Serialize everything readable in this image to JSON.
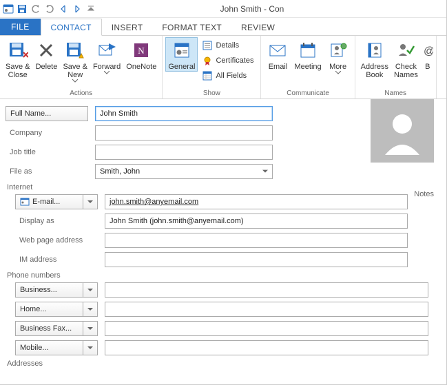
{
  "window": {
    "title": "John Smith - Con"
  },
  "tabs": {
    "file": "FILE",
    "contact": "CONTACT",
    "insert": "INSERT",
    "format_text": "FORMAT TEXT",
    "review": "REVIEW"
  },
  "ribbon": {
    "actions": {
      "save_close": "Save &\nClose",
      "delete": "Delete",
      "save_new": "Save &\nNew",
      "forward": "Forward",
      "onenote": "OneNote",
      "group": "Actions"
    },
    "show": {
      "general": "General",
      "details": "Details",
      "certificates": "Certificates",
      "all_fields": "All Fields",
      "group": "Show"
    },
    "communicate": {
      "email": "Email",
      "meeting": "Meeting",
      "more": "More",
      "group": "Communicate"
    },
    "names": {
      "address_book": "Address\nBook",
      "check_names": "Check\nNames",
      "group": "Names"
    },
    "options_partial": "B"
  },
  "form": {
    "full_name_btn": "Full Name...",
    "full_name_val": "John Smith",
    "company_lbl": "Company",
    "company_val": "",
    "job_title_lbl": "Job title",
    "job_title_val": "",
    "file_as_lbl": "File as",
    "file_as_val": "Smith, John",
    "internet_section": "Internet",
    "email_btn": "E-mail...",
    "email_val": "john.smith@anyemail.com",
    "display_as_lbl": "Display as",
    "display_as_val": "John Smith (john.smith@anyemail.com)",
    "web_lbl": "Web page address",
    "web_val": "",
    "im_lbl": "IM address",
    "im_val": "",
    "phones_section": "Phone numbers",
    "phone_business": "Business...",
    "phone_home": "Home...",
    "phone_bfax": "Business Fax...",
    "phone_mobile": "Mobile...",
    "addresses_section": "Addresses",
    "notes_lbl": "Notes"
  }
}
